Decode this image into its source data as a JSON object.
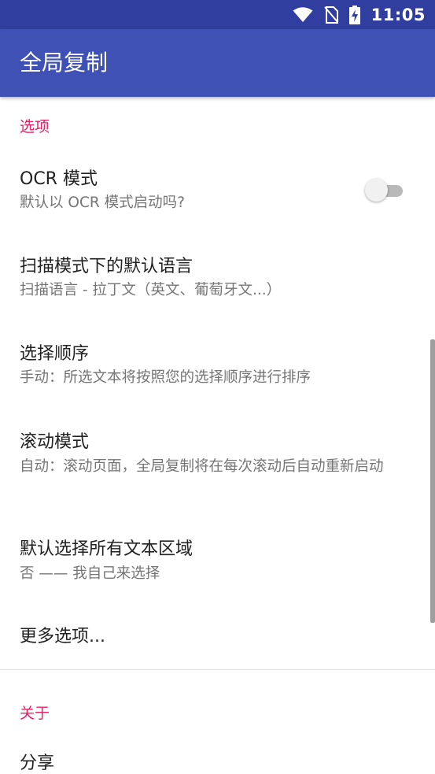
{
  "status_bar": {
    "time": "11:05",
    "icons": [
      "wifi-icon",
      "no-sim-icon",
      "battery-charging-icon"
    ]
  },
  "app_bar": {
    "title": "全局复制"
  },
  "sections": {
    "options": {
      "label": "选项",
      "items": [
        {
          "title": "OCR 模式",
          "summary": "默认以 OCR 模式启动吗?"
        },
        {
          "title": "扫描模式下的默认语言",
          "summary": "扫描语言 - 拉丁文（英文、葡萄牙文...）"
        },
        {
          "title": "选择顺序",
          "summary": "手动：所选文本将按照您的选择顺序进行排序"
        },
        {
          "title": "滚动模式",
          "summary": "自动：滚动页面，全局复制将在每次滚动后自动重新启动"
        },
        {
          "title": "默认选择所有文本区域",
          "summary": "否 —— 我自己来选择"
        },
        {
          "title": "更多选项..."
        }
      ]
    },
    "about": {
      "label": "关于",
      "items": [
        {
          "title": "分享"
        }
      ]
    }
  },
  "ocr_switch": {
    "checked": false
  },
  "colors": {
    "status_bar": "#303f9f",
    "app_bar": "#3f51b5",
    "accent": "#e91e63"
  }
}
